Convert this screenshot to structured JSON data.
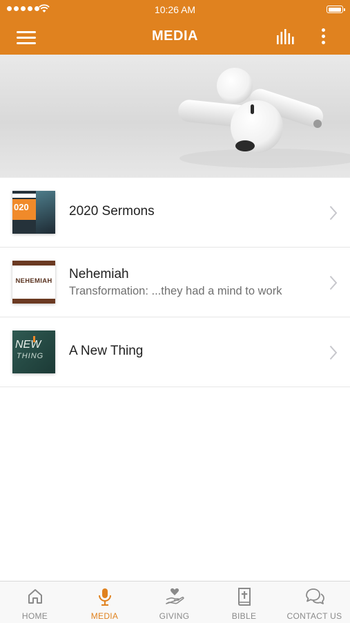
{
  "status_bar": {
    "time": "10:26 AM"
  },
  "header": {
    "title": "MEDIA",
    "menu_icon": "hamburger-menu-icon",
    "stats_icon": "equalizer-bars-icon",
    "more_icon": "vertical-dots-icon",
    "color": "#e0821f"
  },
  "hero": {
    "image": "earbuds-photo"
  },
  "media_list": [
    {
      "title": "2020 Sermons",
      "subtitle": "",
      "thumb_text": "020"
    },
    {
      "title": "Nehemiah",
      "subtitle": "Transformation: ...they had a mind to work",
      "thumb_text": "NEHEMIAH"
    },
    {
      "title": "A New Thing",
      "subtitle": "",
      "thumb_text_1": "NEW",
      "thumb_text_2": "THING"
    }
  ],
  "tabs": [
    {
      "label": "HOME",
      "icon": "home-icon",
      "active": false
    },
    {
      "label": "MEDIA",
      "icon": "microphone-icon",
      "active": true
    },
    {
      "label": "GIVING",
      "icon": "giving-hand-heart-icon",
      "active": false
    },
    {
      "label": "BIBLE",
      "icon": "bible-book-icon",
      "active": false
    },
    {
      "label": "CONTACT US",
      "icon": "chat-bubbles-icon",
      "active": false
    }
  ],
  "colors": {
    "accent": "#e0821f",
    "tab_inactive": "#8a8a8a",
    "text": "#222222",
    "subtext": "#707070"
  }
}
